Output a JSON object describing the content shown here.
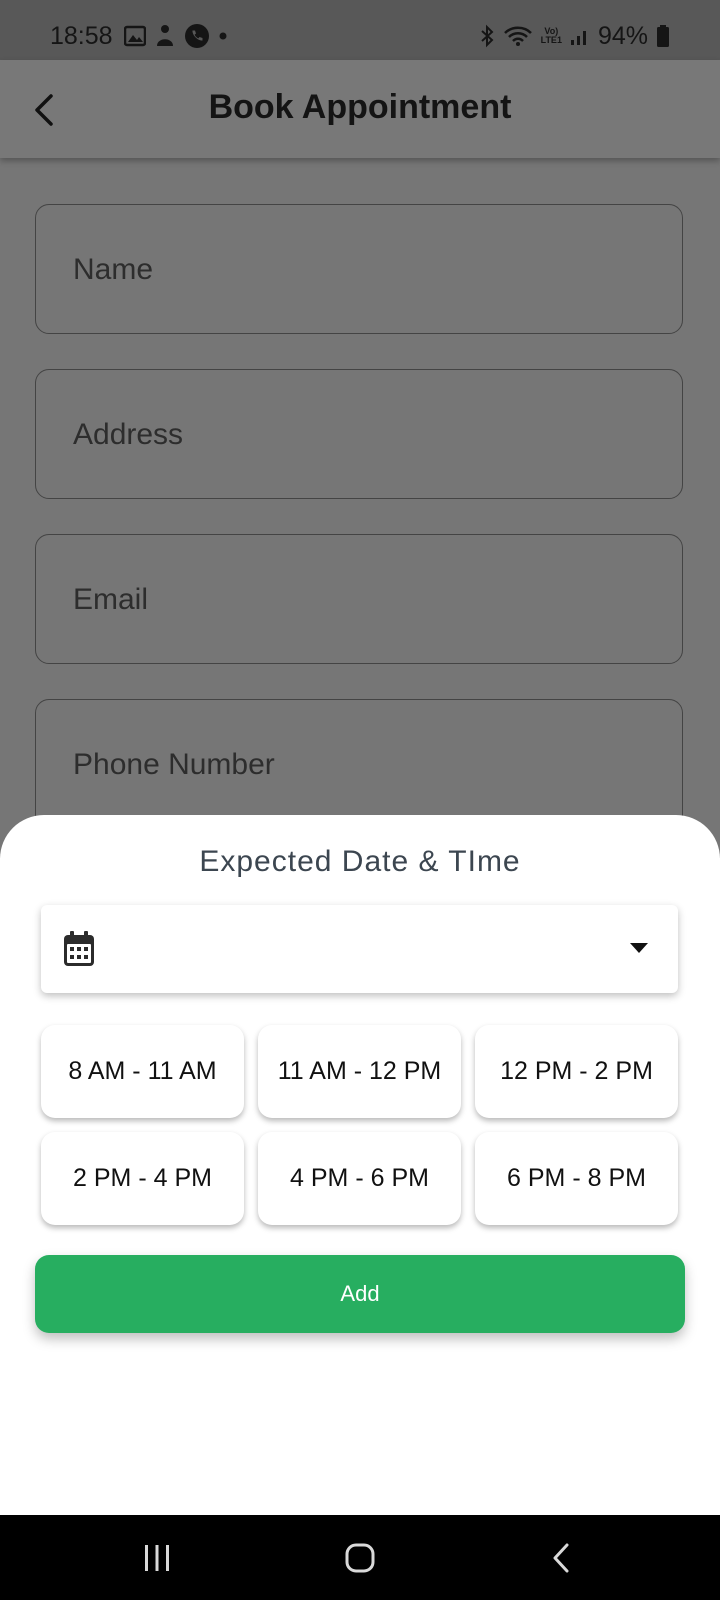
{
  "status_bar": {
    "time": "18:58",
    "network_label": "Vo)\nLTE1",
    "battery_text": "94%",
    "battery_level": 0.94
  },
  "app_bar": {
    "title": "Book Appointment",
    "back_icon": "chevron-left-icon"
  },
  "form": {
    "fields": [
      {
        "placeholder": "Name"
      },
      {
        "placeholder": "Address"
      },
      {
        "placeholder": "Email"
      },
      {
        "placeholder": "Phone Number"
      }
    ]
  },
  "sheet": {
    "title": "Expected Date & TIme",
    "date_select": {
      "value": "",
      "icon": "calendar-icon",
      "dropdown_icon": "dropdown-arrow-icon"
    },
    "time_slots": [
      "8 AM - 11 AM",
      "11 AM - 12 PM",
      "12 PM - 2 PM",
      "2 PM - 4 PM",
      "4 PM - 6 PM",
      "6 PM - 8 PM"
    ],
    "add_button_label": "Add"
  },
  "colors": {
    "accent": "#27ae60",
    "scrim": "#767676",
    "status_bar": "#585858"
  }
}
